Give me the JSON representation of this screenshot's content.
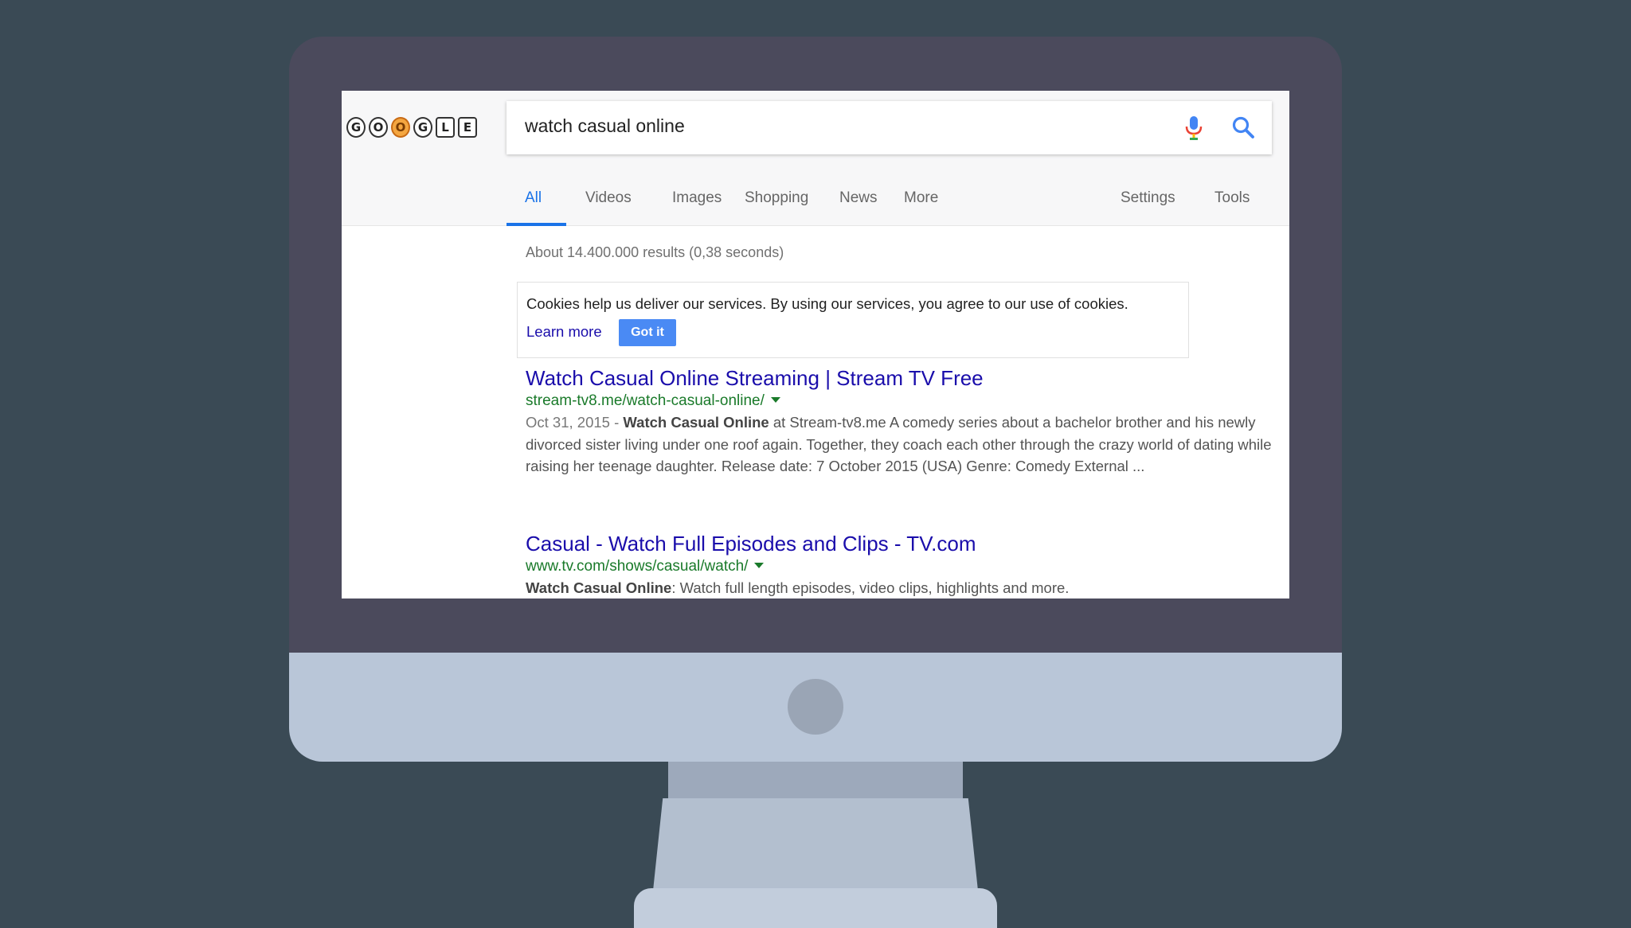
{
  "logo": {
    "letters": [
      "G",
      "O",
      "O",
      "G",
      "L",
      "E"
    ]
  },
  "search": {
    "query": "watch casual online",
    "mic_icon": "microphone-icon",
    "search_icon": "magnifier-icon"
  },
  "tabs": [
    {
      "label": "All",
      "active": true
    },
    {
      "label": "Videos"
    },
    {
      "label": "Images"
    },
    {
      "label": "Shopping"
    },
    {
      "label": "News"
    },
    {
      "label": "More"
    },
    {
      "label": "Settings"
    },
    {
      "label": "Tools"
    }
  ],
  "results_stats": "About 14.400.000 results (0,38 seconds)",
  "cookie_notice": {
    "text": "Cookies help us deliver our services. By using our services, you agree to our use of cookies.",
    "learn_more": "Learn more",
    "button": "Got it"
  },
  "results": [
    {
      "title": "Watch Casual Online Streaming | Stream TV Free",
      "url": "stream-tv8.me/watch-casual-online/",
      "date": "Oct 31, 2015 - ",
      "bold": "Watch Casual Online",
      "snippet": " at Stream-tv8.me A comedy series about a bachelor brother and his newly divorced sister living under one roof again. Together, they coach each other through the crazy world of dating while raising her teenage daughter. Release date: 7 October 2015 (USA) Genre: Comedy External ..."
    },
    {
      "title": "Casual - Watch Full Episodes and Clips - TV.com",
      "url": "www.tv.com/shows/casual/watch/",
      "bold": "Watch Casual Online",
      "snippet": ": Watch full length episodes, video clips, highlights and more."
    }
  ],
  "colors": {
    "background": "#3a4a55",
    "bezel": "#4b4a5c",
    "chin": "#b9c6d8",
    "link": "#1a0dab",
    "url_green": "#1a7a2a",
    "accent_blue": "#1a73e8"
  }
}
